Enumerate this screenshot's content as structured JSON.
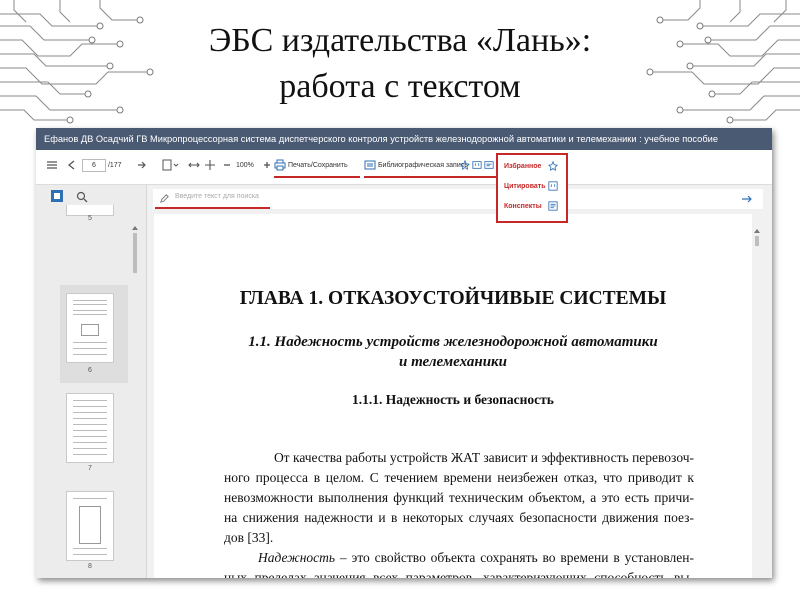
{
  "slide": {
    "title_line1": "ЭБС издательства «Лань»:",
    "title_line2": "работа с текстом"
  },
  "viewer": {
    "book_title": "Ефанов ДВ Осадчий ГВ Микропроцессорная система диспетчерского контроля устройств железнодорожной автоматики и телемеханики : учебное пособие",
    "toolbar": {
      "page_current": "6",
      "page_total": "/177",
      "zoom": "100%",
      "print_save": "Печать/Сохранить",
      "bibliographic": "Библиографическая запись"
    },
    "popup": {
      "favorites": "Избранное",
      "cite": "Цитировать",
      "notes": "Конспекты"
    },
    "search": {
      "placeholder": "Введите текст для поиска"
    },
    "thumbnails": [
      {
        "label": "5"
      },
      {
        "label": "6"
      },
      {
        "label": "7"
      },
      {
        "label": "8"
      }
    ],
    "page": {
      "chapter": "ГЛАВА 1. ОТКАЗОУСТОЙЧИВЫЕ СИСТЕМЫ",
      "section_line1": "1.1. Надежность устройств железнодорожной автоматики",
      "section_line2": "и телемеханики",
      "subsection": "1.1.1. Надежность и безопасность",
      "para1_lines": [
        "От качества работы устройств ЖАТ зависит и эффективность перевозоч-",
        "ного процесса в целом. С течением времени неизбежен отказ, что приводит к",
        "невозможности выполнения функций техническим объектом, а это есть причи-",
        "на снижения надежности и в некоторых случаях безопасности движения поез-",
        "дов [33]."
      ],
      "para2_term": "Надежность",
      "para2_rest": " – это свойство объекта сохранять во времени в установлен-",
      "para2_line2": "ных пределах значения всех параметров, характеризующих способность вы-"
    },
    "colors": {
      "accent": "#c62828",
      "titlebar": "#4a5a73",
      "icon_blue": "#2f6fb3"
    }
  }
}
